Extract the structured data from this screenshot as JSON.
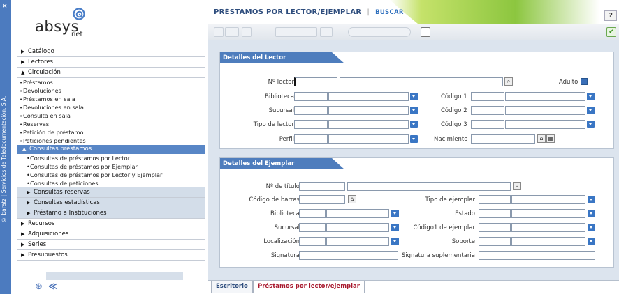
{
  "strip": {
    "close": "×",
    "vertical_text": "© baratz | Servicios de Teledocumentación, S.A."
  },
  "logo": {
    "brand": "absys",
    "suffix": "net"
  },
  "sidebar": {
    "items": [
      {
        "label": "Catálogo"
      },
      {
        "label": "Lectores"
      },
      {
        "label": "Circulación"
      }
    ],
    "circulacion_subitems": [
      "Préstamos",
      "Devoluciones",
      "Préstamos en sala",
      "Devoluciones en sala",
      "Consulta en sala",
      "Reservas",
      "Petición de préstamo",
      "Peticiones pendientes"
    ],
    "active_group": "Consultas préstamos",
    "consultas_subitems": [
      "Consultas de préstamos por Lector",
      "Consultas de préstamos por Ejemplar",
      "Consultas de préstamos por Lector y Ejemplar",
      "Consultas de peticiones"
    ],
    "gray_groups": [
      "Consultas reservas",
      "Consultas estadísticas",
      "Préstamo a Instituciones"
    ],
    "bottom_items": [
      "Recursos",
      "Adquisiciones",
      "Series",
      "Presupuestos"
    ]
  },
  "header": {
    "title": "PRÉSTAMOS POR LECTOR/EJEMPLAR",
    "separator": "|",
    "buscar": "BUSCAR",
    "help": "?"
  },
  "lector": {
    "section_title": "Detalles del Lector",
    "n_lector": "Nº lector",
    "adulto": "Adulto",
    "biblioteca": "Biblioteca",
    "sucursal": "Sucursal",
    "tipo_lector": "Tipo de lector",
    "perfil": "Perfil",
    "codigo1": "Código 1",
    "codigo2": "Código 2",
    "codigo3": "Código 3",
    "nacimiento": "Nacimiento"
  },
  "ejemplar": {
    "section_title": "Detalles del Ejemplar",
    "n_titulo": "Nº de título",
    "codigo_barras": "Código de barras",
    "biblioteca": "Biblioteca",
    "sucursal": "Sucursal",
    "localizacion": "Localización",
    "signatura": "Signatura",
    "tipo_ejemplar": "Tipo de ejemplar",
    "estado": "Estado",
    "codigo1_ejemplar": "Código1 de ejemplar",
    "soporte": "Soporte",
    "signatura_suplementaria": "Signatura suplementaria"
  },
  "tabs": [
    {
      "label": "Escritorio"
    },
    {
      "label": "Préstamos por lector/ejemplar"
    }
  ],
  "colors": {
    "accent": "#4c7bbf",
    "active_menu": "#5886c6",
    "tab_active_text": "#a8192e",
    "green_band": "#9acd32"
  }
}
